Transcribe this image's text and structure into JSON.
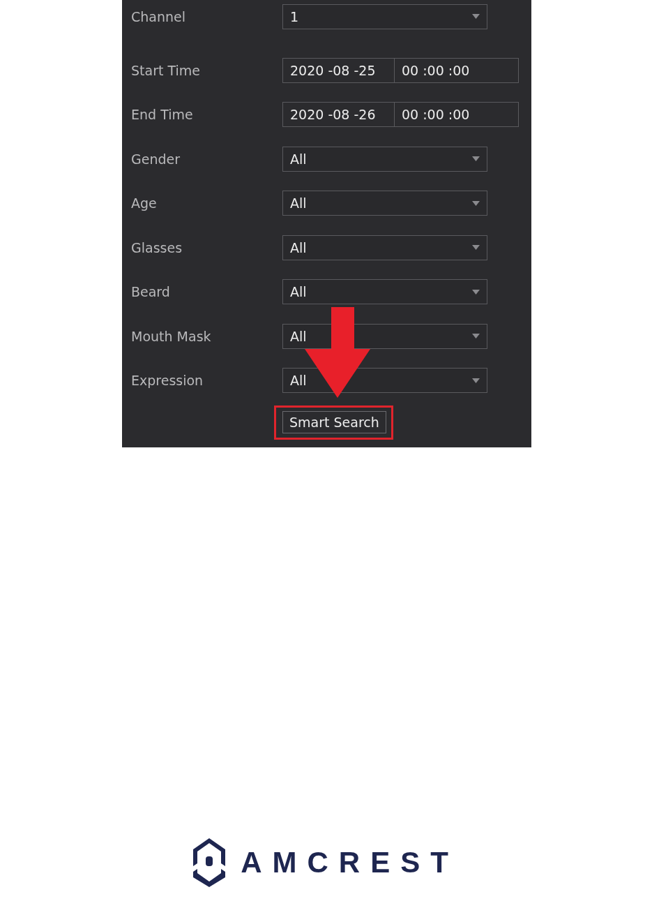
{
  "search_form": {
    "fields": [
      {
        "label": "Channel",
        "kind": "select",
        "value": "1"
      },
      {
        "label": "Start Time",
        "kind": "datetime",
        "date": "2020 -08 -25",
        "time": "00 :00 :00"
      },
      {
        "label": "End Time",
        "kind": "datetime",
        "date": "2020 -08 -26",
        "time": "00 :00 :00"
      },
      {
        "label": "Gender",
        "kind": "select",
        "value": "All"
      },
      {
        "label": "Age",
        "kind": "select",
        "value": "All"
      },
      {
        "label": "Glasses",
        "kind": "select",
        "value": "All"
      },
      {
        "label": "Beard",
        "kind": "select",
        "value": "All"
      },
      {
        "label": "Mouth Mask",
        "kind": "select",
        "value": "All"
      },
      {
        "label": "Expression",
        "kind": "select",
        "value": "All"
      }
    ],
    "button": "Smart Search"
  },
  "logo": {
    "text": "AMCREST"
  }
}
